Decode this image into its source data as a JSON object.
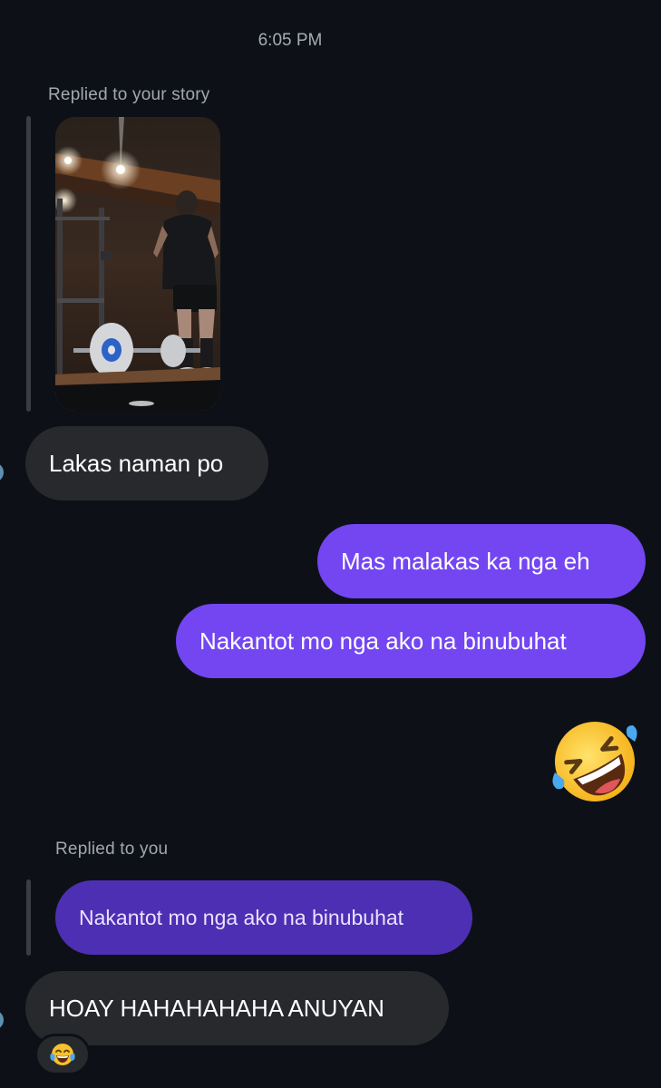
{
  "conversation": {
    "timestamp": "6:05 PM",
    "story_reply_label": "Replied to your story",
    "reply_label": "Replied to you",
    "messages": {
      "received_1": "Lakas naman po",
      "sent_1": "Mas malakas ka nga eh",
      "sent_2": "Nakantot mo nga ako na binubuhat",
      "quoted": "Nakantot mo nga ako na binubuhat",
      "received_2": "HOAY HAHAHAHAHA ANUYAN"
    },
    "emoji_message": "rolling-on-floor-laughing-emoji",
    "reaction": "tears-of-joy-emoji"
  },
  "colors": {
    "background": "#0d1117",
    "received_bubble": "#27292d",
    "sent_bubble": "#7346f2",
    "quoted_bubble": "#4d2fb3",
    "muted_text": "#a3a8b0"
  }
}
